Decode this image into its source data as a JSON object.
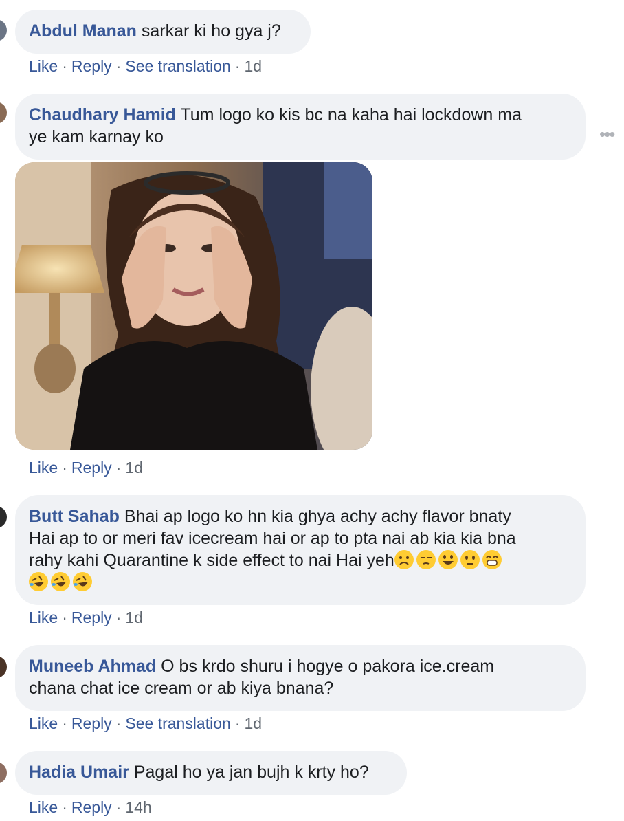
{
  "comments": [
    {
      "author": "Abdul Manan",
      "text": "sarkar ki ho gya j?",
      "like": "Like",
      "reply": "Reply",
      "see_translation": "See translation",
      "time": "1d"
    },
    {
      "author": "Chaudhary Hamid",
      "text_line1": "Tum logo ko kis bc na kaha hai lockdown ma",
      "text_line2": "ye kam karnay ko",
      "like": "Like",
      "reply": "Reply",
      "time": "1d"
    },
    {
      "author": "Butt Sahab",
      "text_line1": "Bhai ap logo ko hn kia ghya achy achy flavor bnaty",
      "text_line2": "Hai ap to or meri fav icecream hai or ap to pta nai ab kia kia bna",
      "text_line3": "rahy kahi Quarantine k side effect to nai Hai yeh",
      "emojis_line3": [
        "frowning-face",
        "unamused-face",
        "grinning-face",
        "neutral-face",
        "beaming-face"
      ],
      "emojis_line4": [
        "rolling-laughing-face",
        "rolling-laughing-face",
        "rolling-laughing-face"
      ],
      "like": "Like",
      "reply": "Reply",
      "time": "1d"
    },
    {
      "author": "Muneeb Ahmad",
      "text_line1": "O bs krdo shuru i hogye o pakora ice.cream",
      "text_line2": "chana chat ice cream or ab kiya bnana?",
      "like": "Like",
      "reply": "Reply",
      "see_translation": "See translation",
      "time": "1d"
    },
    {
      "author": "Hadia Umair",
      "text": "Pagal ho ya jan bujh k krty ho?",
      "like": "Like",
      "reply": "Reply",
      "time": "14h"
    }
  ],
  "more_icon": "ellipsis-horizontal-icon",
  "colors": {
    "author": "#385898",
    "bubble_bg": "#f0f2f5",
    "meta": "#606770",
    "emoji_yellow": "#ffcc33"
  }
}
